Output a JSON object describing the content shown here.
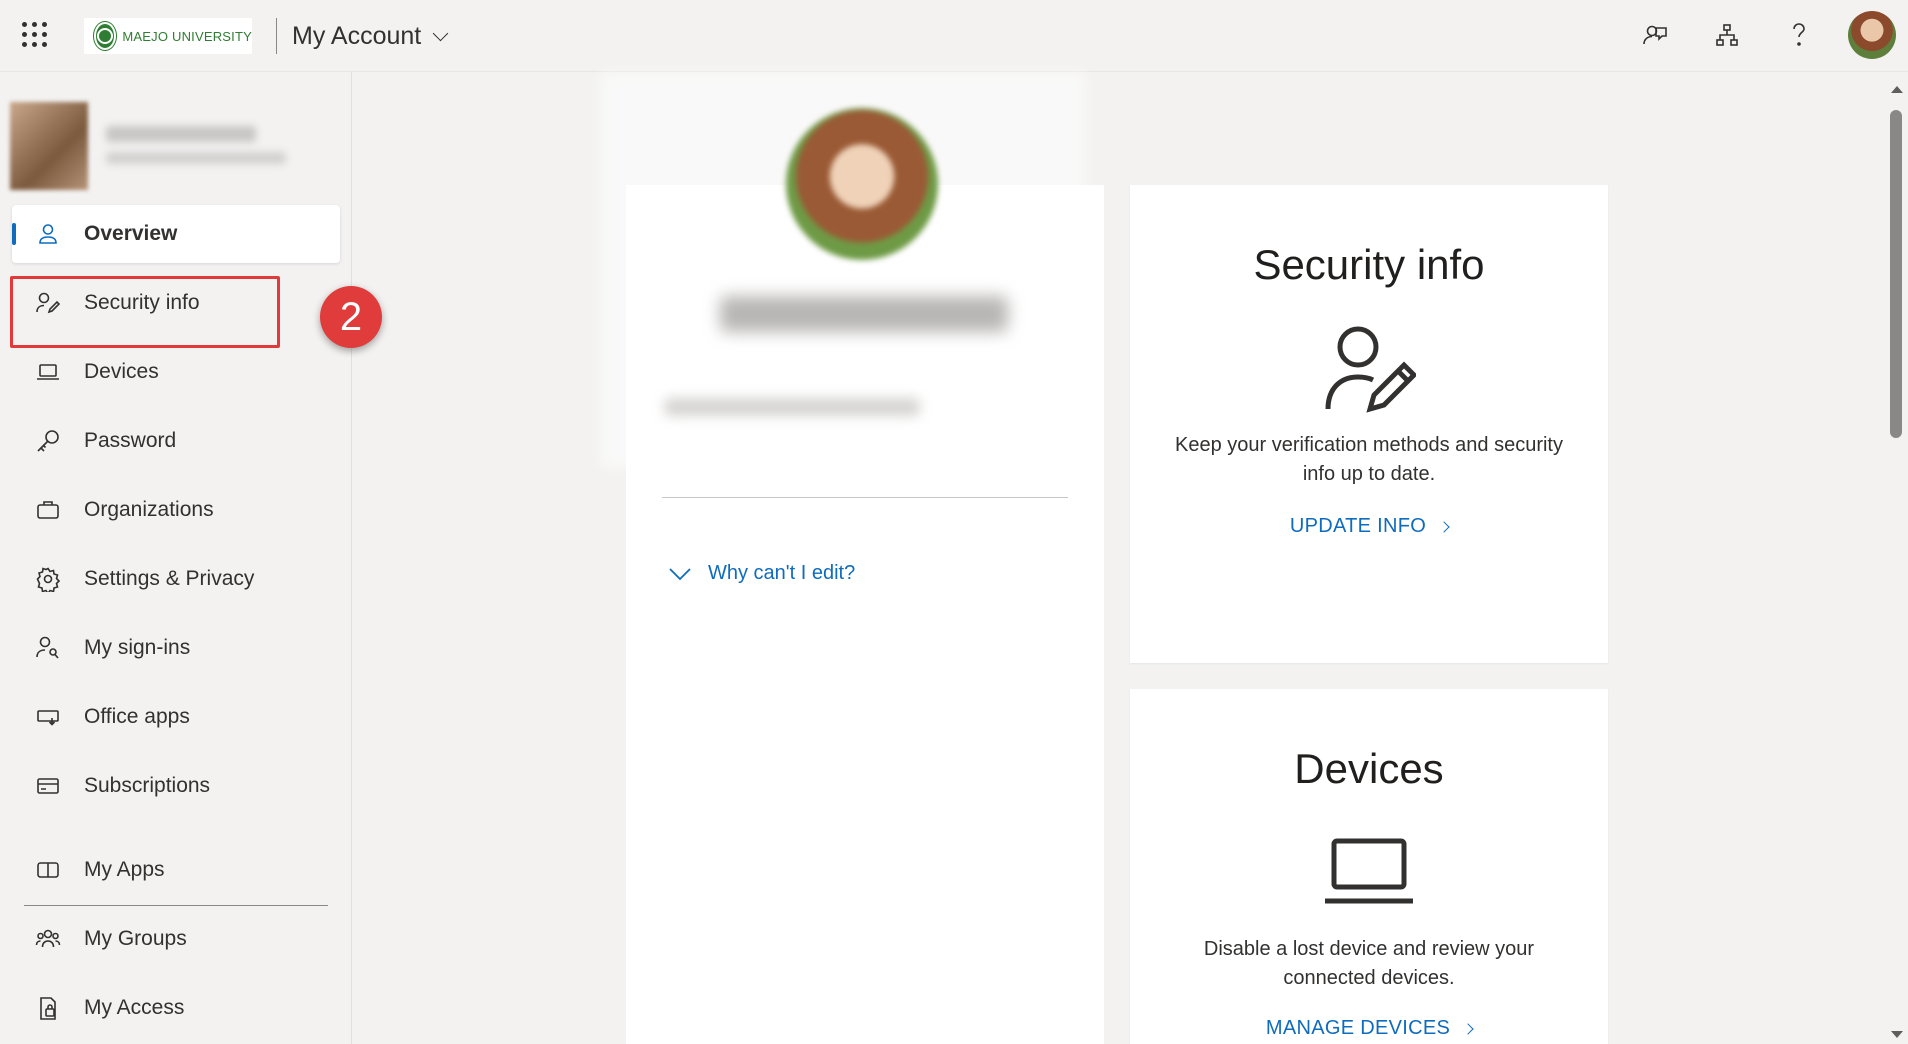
{
  "header": {
    "logo_text": "MAEJO UNIVERSITY",
    "app_title": "My Account",
    "icons": [
      "feedback-icon",
      "org-chart-icon",
      "help-icon"
    ]
  },
  "sidebar": {
    "items": [
      {
        "label": "Overview",
        "icon": "person-icon",
        "active": true
      },
      {
        "label": "Security info",
        "icon": "person-edit-icon"
      },
      {
        "label": "Devices",
        "icon": "laptop-icon"
      },
      {
        "label": "Password",
        "icon": "key-icon"
      },
      {
        "label": "Organizations",
        "icon": "briefcase-icon"
      },
      {
        "label": "Settings & Privacy",
        "icon": "gear-icon"
      },
      {
        "label": "My sign-ins",
        "icon": "person-key-icon"
      },
      {
        "label": "Office apps",
        "icon": "office-apps-icon"
      },
      {
        "label": "Subscriptions",
        "icon": "card-icon"
      },
      {
        "label": "My Apps",
        "icon": "apps-icon"
      },
      {
        "label": "My Groups",
        "icon": "groups-icon"
      },
      {
        "label": "My Access",
        "icon": "access-icon"
      }
    ],
    "step_badge": "2"
  },
  "profile": {
    "why_edit": "Why can't I edit?"
  },
  "tiles": {
    "security": {
      "title": "Security info",
      "description": "Keep your verification methods and security info up to date.",
      "link": "UPDATE INFO"
    },
    "devices": {
      "title": "Devices",
      "description": "Disable a lost device and review your connected devices.",
      "link": "MANAGE DEVICES"
    }
  },
  "colors": {
    "accent": "#0f6cbd",
    "highlight": "#e23a3a",
    "background": "#f3f2f1"
  }
}
